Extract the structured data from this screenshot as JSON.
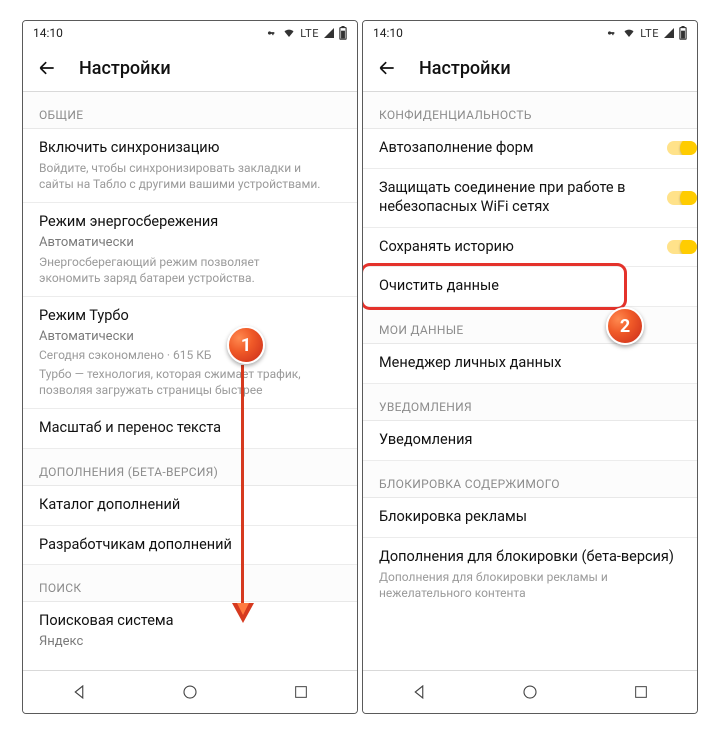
{
  "status": {
    "time": "14:10",
    "lte": "LTE"
  },
  "header": {
    "title": "Настройки"
  },
  "left": {
    "section_general": "ОБЩИЕ",
    "sync_title": "Включить синхронизацию",
    "sync_sub": "Войдите, чтобы синхронизировать закладки и сайты на Табло с другими вашими устройствами.",
    "power_title": "Режим энергосбережения",
    "power_value": "Автоматически",
    "power_sub": "Энергосберегающий режим позволяет экономить заряд батареи устройства.",
    "turbo_title": "Режим Турбо",
    "turbo_value": "Автоматически",
    "turbo_sub1": "Сегодня сэкономлено · 615 КБ",
    "turbo_sub2": "Турбо — технология, которая сжимает трафик, позволяя загружать страницы быстрее",
    "scale_title": "Масштаб и перенос текста",
    "section_addons": "ДОПОЛНЕНИЯ (БЕТА-ВЕРСИЯ)",
    "addons_catalog": "Каталог дополнений",
    "addons_dev": "Разработчикам дополнений",
    "section_search": "ПОИСК",
    "search_engine_title": "Поисковая система",
    "search_engine_value": "Яндекс"
  },
  "right": {
    "section_privacy": "КОНФИДЕНЦИАЛЬНОСТЬ",
    "autofill": "Автозаполнение форм",
    "protect_wifi": "Защищать соединение при работе в небезопасных WiFi сетях",
    "save_history": "Сохранять историю",
    "clear_data": "Очистить данные",
    "section_mydata": "МОИ ДАННЫЕ",
    "personal_manager": "Менеджер личных данных",
    "section_notifications": "УВЕДОМЛЕНИЯ",
    "notifications": "Уведомления",
    "section_blocking": "БЛОКИРОВКА СОДЕРЖИМОГО",
    "adblock": "Блокировка рекламы",
    "adblock_addons": "Дополнения для блокировки (бета-версия)",
    "adblock_addons_sub": "Дополнения для блокировки рекламы и нежелательного контента"
  },
  "annotations": {
    "badge1": "1",
    "badge2": "2"
  }
}
